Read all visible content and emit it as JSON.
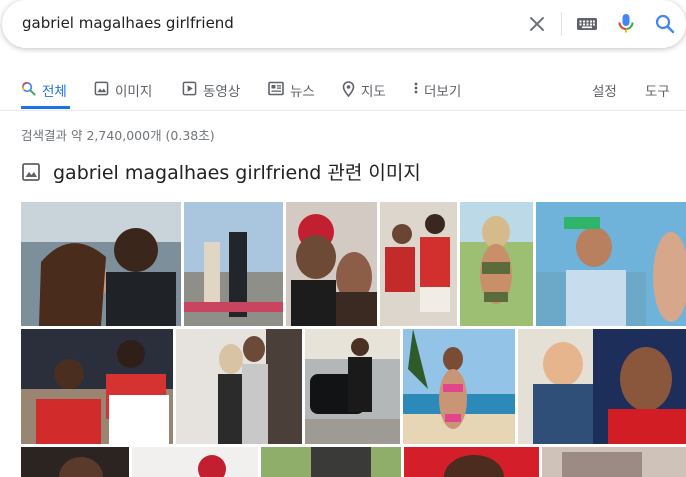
{
  "search": {
    "query": "gabriel magalhaes girlfriend",
    "clear_icon": "close-icon",
    "keyboard_icon": "keyboard-icon",
    "mic_icon": "microphone-icon",
    "search_icon": "search-icon"
  },
  "tabs": {
    "all": "전체",
    "images": "이미지",
    "videos": "동영상",
    "news": "뉴스",
    "maps": "지도",
    "more": "더보기",
    "settings": "설정",
    "tools": "도구"
  },
  "stats": "검색결과 약 2,740,000개 (0.38초)",
  "images_section": {
    "title": "gabriel magalhaes girlfriend 관련 이미지",
    "icon": "image-icon"
  },
  "colors": {
    "accent": "#1a73e8",
    "mic_blue": "#4285f4",
    "mic_red": "#ea4335",
    "text_secondary": "#5f6368"
  }
}
